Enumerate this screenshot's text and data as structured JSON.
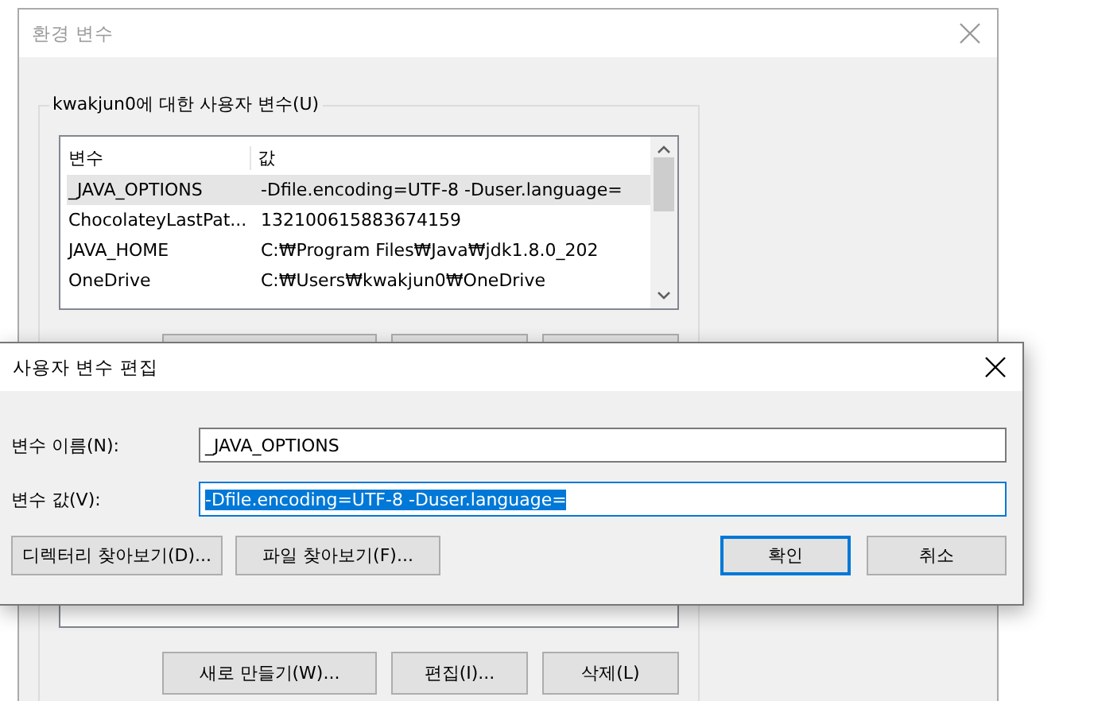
{
  "env_window": {
    "title": "환경 변수",
    "user_group": {
      "label": "kwakjun0에 대한 사용자 변수(U)",
      "columns": [
        "변수",
        "값"
      ],
      "rows": [
        {
          "name": "_JAVA_OPTIONS",
          "value": "-Dfile.encoding=UTF-8 -Duser.language=",
          "selected": true
        },
        {
          "name": "ChocolateyLastPat...",
          "value": "132100615883674159",
          "selected": false
        },
        {
          "name": "JAVA_HOME",
          "value": "C:₩Program Files₩Java₩jdk1.8.0_202",
          "selected": false
        },
        {
          "name": "OneDrive",
          "value": "C:₩Users₩kwakjun0₩OneDrive",
          "selected": false
        }
      ]
    },
    "system_group": {
      "buttons": [
        "새로 만들기(W)...",
        "편집(I)...",
        "삭제(L)"
      ]
    }
  },
  "edit_dialog": {
    "title": "사용자 변수 편집",
    "fields": [
      {
        "label": "변수 이름(N):",
        "value": "_JAVA_OPTIONS",
        "selected": false
      },
      {
        "label": "변수 값(V):",
        "value": "-Dfile.encoding=UTF-8 -Duser.language=",
        "selected": true
      }
    ],
    "browse_buttons": [
      "디렉터리 찾아보기(D)...",
      "파일 찾아보기(F)..."
    ],
    "buttons": [
      {
        "label": "확인",
        "default": true
      },
      {
        "label": "취소",
        "default": false
      }
    ]
  }
}
